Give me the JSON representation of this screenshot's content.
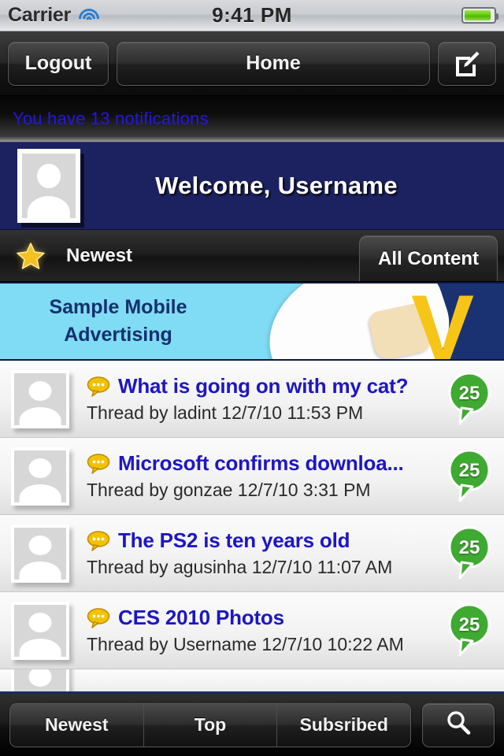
{
  "statusbar": {
    "carrier": "Carrier",
    "time": "9:41 PM",
    "wifi_icon": "wifi-icon",
    "battery_icon": "battery-icon"
  },
  "navbar": {
    "logout_label": "Logout",
    "home_label": "Home",
    "compose_icon": "compose-icon"
  },
  "notification": {
    "text": "You have 13 notifications",
    "count": 13,
    "color": "#2417e0"
  },
  "welcome": {
    "title": "Welcome, Username",
    "avatar_icon": "user-avatar-placeholder",
    "background": "#1c2260"
  },
  "filterbar": {
    "star_icon": "star-icon",
    "label": "Newest",
    "all_content_label": "All Content"
  },
  "ad": {
    "line1": "Sample Mobile",
    "line2": "Advertising",
    "logo_text": "V",
    "background": "#7fdcf4",
    "text_color": "#16306e"
  },
  "list": {
    "items": [
      {
        "title": "What is going on with my cat?",
        "meta": "Thread by ladint 12/7/10 11:53 PM",
        "count": "25",
        "bubble_icon": "comment-bubble-icon",
        "avatar_icon": "user-avatar-placeholder"
      },
      {
        "title": "Microsoft confirms downloa...",
        "meta": "Thread by gonzae 12/7/10 3:31 PM",
        "count": "25",
        "bubble_icon": "comment-bubble-icon",
        "avatar_icon": "user-avatar-placeholder"
      },
      {
        "title": "The PS2 is ten years old",
        "meta": "Thread by agusinha 12/7/10 11:07 AM",
        "count": "25",
        "bubble_icon": "comment-bubble-icon",
        "avatar_icon": "user-avatar-placeholder"
      },
      {
        "title": "CES 2010 Photos",
        "meta": "Thread by Username 12/7/10 10:22 AM",
        "count": "25",
        "bubble_icon": "comment-bubble-icon",
        "avatar_icon": "user-avatar-placeholder"
      }
    ]
  },
  "toolbar": {
    "newest_label": "Newest",
    "top_label": "Top",
    "subscribed_label": "Subsribed",
    "search_icon": "search-icon"
  },
  "colors": {
    "badge_green": "#3faa31",
    "link_blue": "#1d16c4",
    "navy": "#1c2260",
    "ad_cyan": "#7fdcf4"
  }
}
